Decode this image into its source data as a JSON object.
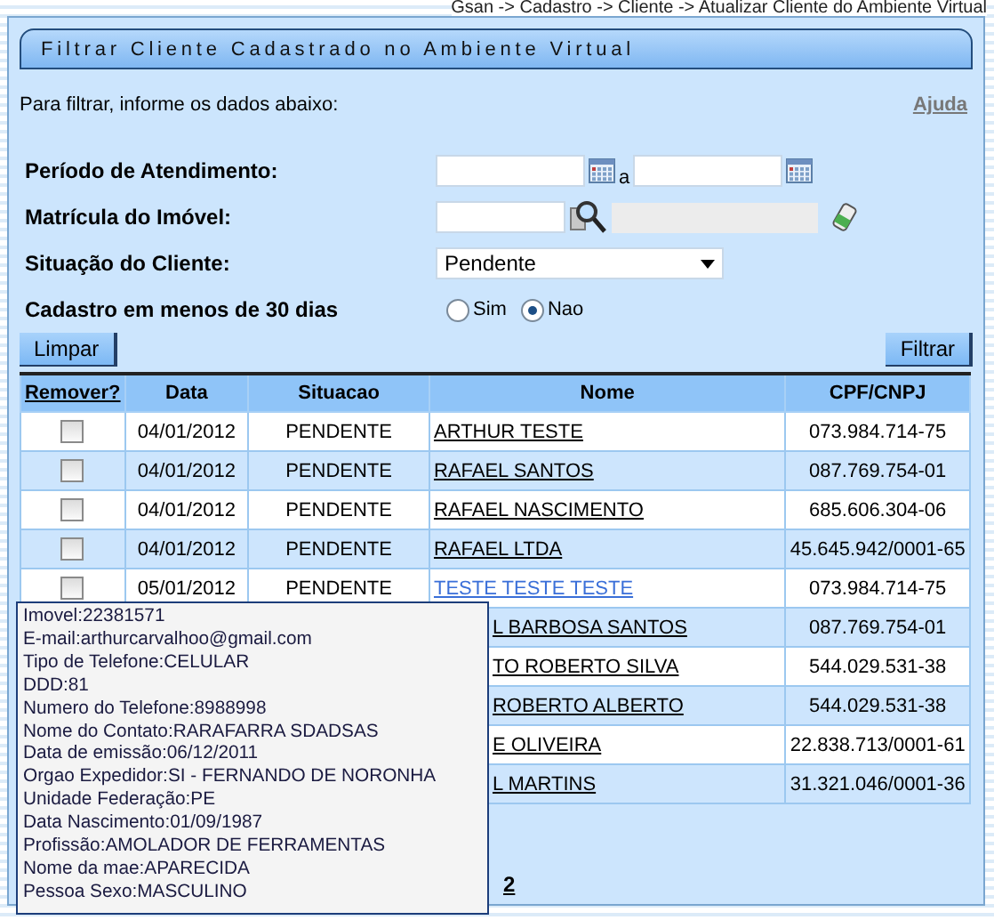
{
  "breadcrumb": "Gsan -> Cadastro -> Cliente -> Atualizar Cliente do Ambiente Virtual",
  "panel": {
    "title": "Filtrar Cliente Cadastrado no Ambiente Virtual",
    "intro": "Para filtrar, informe os dados abaixo:",
    "help_link": "Ajuda"
  },
  "form": {
    "periodo_label": "Período de Atendimento:",
    "periodo_sep": "a",
    "matricula_label": "Matrícula do Imóvel:",
    "situacao_label": "Situação do Cliente:",
    "situacao_value": "Pendente",
    "cadastro_label": "Cadastro em menos de 30 dias",
    "cadastro_options": [
      {
        "label": "Sim",
        "selected": false
      },
      {
        "label": "Nao",
        "selected": true
      }
    ]
  },
  "buttons": {
    "clear": "Limpar",
    "filter": "Filtrar"
  },
  "table": {
    "columns": [
      "Remover?",
      "Data",
      "Situacao",
      "Nome",
      "CPF/CNPJ"
    ],
    "rows": [
      {
        "kind": "full",
        "checked": false,
        "date": "04/01/2012",
        "status": "PENDENTE",
        "name": "ARTHUR TESTE",
        "hovered": false,
        "doc": "073.984.714-75"
      },
      {
        "kind": "full",
        "checked": false,
        "date": "04/01/2012",
        "status": "PENDENTE",
        "name": "RAFAEL SANTOS",
        "hovered": false,
        "doc": "087.769.754-01"
      },
      {
        "kind": "full",
        "checked": false,
        "date": "04/01/2012",
        "status": "PENDENTE",
        "name": "RAFAEL NASCIMENTO",
        "hovered": false,
        "doc": "685.606.304-06"
      },
      {
        "kind": "full",
        "checked": false,
        "date": "04/01/2012",
        "status": "PENDENTE",
        "name": "RAFAEL LTDA",
        "hovered": false,
        "doc": "45.645.942/0001-65"
      },
      {
        "kind": "full",
        "checked": false,
        "date": "05/01/2012",
        "status": "PENDENTE",
        "name": "TESTE TESTE TESTE",
        "hovered": true,
        "doc": "073.984.714-75"
      },
      {
        "kind": "covered",
        "name": "L BARBOSA SANTOS",
        "doc": "087.769.754-01"
      },
      {
        "kind": "covered",
        "name": "TO ROBERTO SILVA",
        "doc": "544.029.531-38"
      },
      {
        "kind": "covered",
        "name": "ROBERTO ALBERTO",
        "doc": "544.029.531-38"
      },
      {
        "kind": "covered",
        "name": "E OLIVEIRA",
        "doc": "22.838.713/0001-61"
      },
      {
        "kind": "covered",
        "name": "L MARTINS",
        "doc": "31.321.046/0001-36"
      }
    ]
  },
  "pagination": {
    "page": "2"
  },
  "tooltip": {
    "lines": [
      "Imovel:22381571",
      "E-mail:arthurcarvalhoo@gmail.com",
      "Tipo de Telefone:CELULAR",
      "DDD:81",
      "Numero do Telefone:8988998",
      "Nome do Contato:RARAFARRA SDADSAS",
      "Data de emissão:06/12/2011",
      "Orgao Expedidor:SI - FERNANDO DE NORONHA",
      "Unidade Federação:PE",
      "Data Nascimento:01/09/1987",
      "Profissão:AMOLADOR DE FERRAMENTAS",
      "Nome da mae:APARECIDA",
      "Pessoa Sexo:MASCULINO"
    ]
  }
}
